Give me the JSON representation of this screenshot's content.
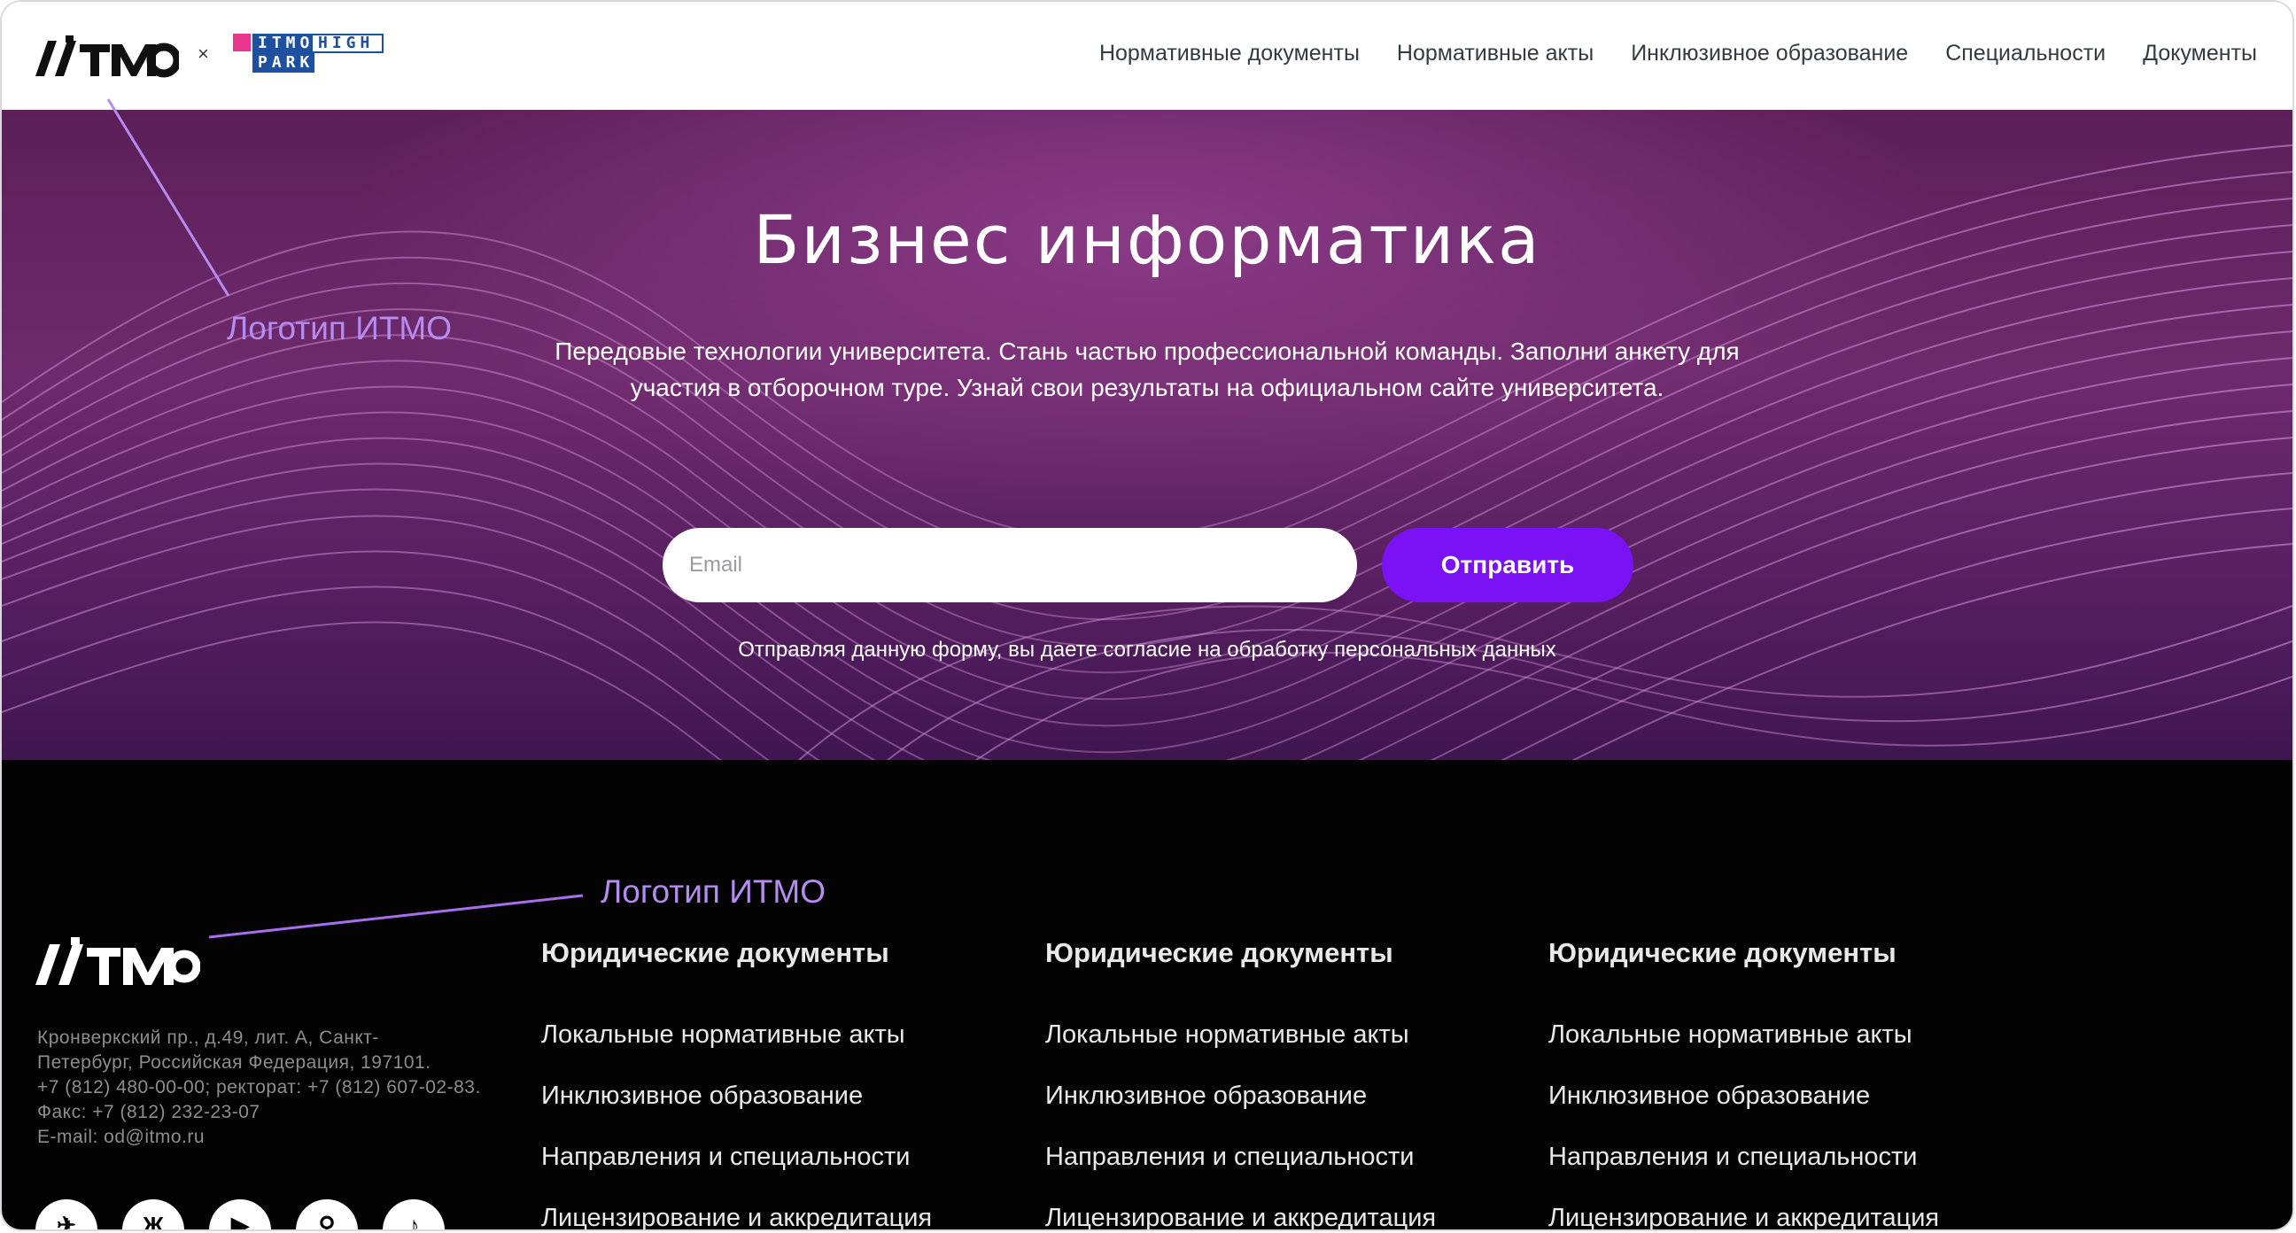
{
  "header": {
    "logo_text": "ИТМО",
    "partner_separator": "×",
    "partner_logo": {
      "line1_a": "ITMO",
      "line1_b": "HIGH",
      "line2": "PARK",
      "accent_color": "#e8368f",
      "brand_color": "#1e50a0"
    },
    "nav": [
      {
        "label": "Нормативные документы"
      },
      {
        "label": "Нормативные акты"
      },
      {
        "label": "Инклюзивное образование"
      },
      {
        "label": "Специальности"
      },
      {
        "label": "Документы"
      }
    ]
  },
  "hero": {
    "title": "Бизнес информатика",
    "description": "Передовые технологии университета. Стань частью профессиональной команды. Заполни анкету для участия в отборочном туре. Узнай свои результаты на официальном сайте университета.",
    "email_placeholder": "Email",
    "email_value": "",
    "submit_label": "Отправить",
    "consent": "Отправляя данную форму, вы даете согласие на обработку персональных данных",
    "button_color": "#7b12f5"
  },
  "callouts": {
    "header_logo": "Логотип ИТМО",
    "footer_logo": "Логотип ИТМО",
    "color": "#b58cf0"
  },
  "footer": {
    "logo_text": "ИТМО",
    "address_lines": [
      "Кронверкский пр., д.49, лит. А, Санкт-",
      "Петербург, Российская Федерация, 197101.",
      "+7 (812) 480-00-00; ректорат: +7 (812) 607-02-83.",
      "Факс: +7 (812) 232-23-07",
      "E-mail: od@itmo.ru"
    ],
    "socials": [
      {
        "icon": "telegram-icon",
        "glyph": "✈"
      },
      {
        "icon": "vk-icon",
        "glyph": "Ж"
      },
      {
        "icon": "youtube-icon",
        "glyph": "▶"
      },
      {
        "icon": "location-icon",
        "glyph": "⚲"
      },
      {
        "icon": "tiktok-icon",
        "glyph": "♪"
      }
    ],
    "columns": [
      {
        "title": "Юридические документы",
        "links": [
          "Локальные нормативные акты",
          "Инклюзивное образование",
          "Направления и специальности",
          "Лицензирование и аккредитация"
        ]
      },
      {
        "title": "Юридические документы",
        "links": [
          "Локальные нормативные акты",
          "Инклюзивное образование",
          "Направления и специальности",
          "Лицензирование и аккредитация"
        ]
      },
      {
        "title": "Юридические документы",
        "links": [
          "Локальные нормативные акты",
          "Инклюзивное образование",
          "Направления и специальности",
          "Лицензирование и аккредитация"
        ]
      }
    ]
  }
}
